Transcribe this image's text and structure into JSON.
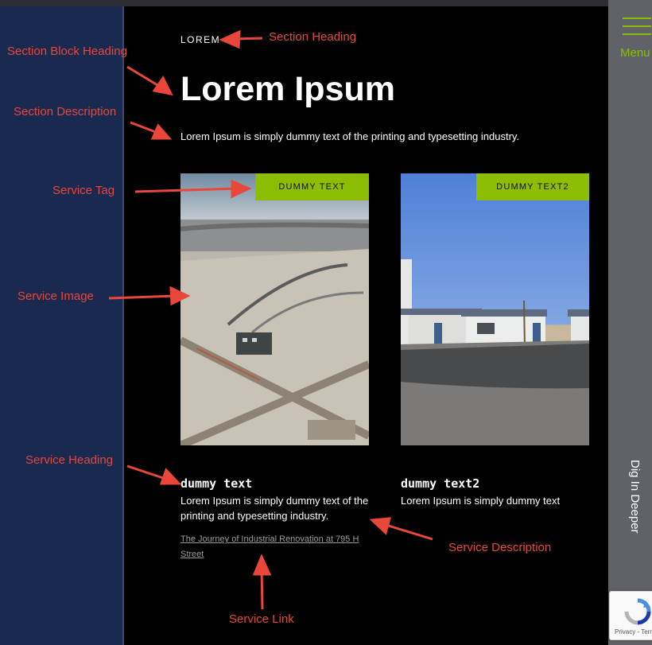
{
  "header": {
    "menu_label": "Menu",
    "dig_label": "Dig In Deeper"
  },
  "section": {
    "heading": "LOREM",
    "block_heading": "Lorem Ipsum",
    "description": "Lorem Ipsum is simply dummy text of the printing and typesetting industry."
  },
  "services": [
    {
      "tag": "DUMMY TEXT",
      "heading": "dummy text",
      "description": "Lorem Ipsum is simply dummy text of the printing and typesetting industry.",
      "link": "The Journey of Industrial Renovation at 795 H Street"
    },
    {
      "tag": "DUMMY TEXT2",
      "heading": "dummy text2",
      "description": "Lorem Ipsum is simply dummy text"
    }
  ],
  "annotations": {
    "section_heading": "Section Heading",
    "section_block_heading": "Section Block Heading",
    "section_description": "Section Description",
    "service_tag": "Service Tag",
    "service_image": "Service Image",
    "service_heading": "Service Heading",
    "service_description": "Service Description",
    "service_link": "Service Link"
  },
  "recaptcha": {
    "terms": "Privacy - Terms"
  },
  "colors": {
    "accent": "#8cbd00",
    "annotation": "#e8473a",
    "left_panel": "#19294f",
    "main_bg": "#000000"
  }
}
